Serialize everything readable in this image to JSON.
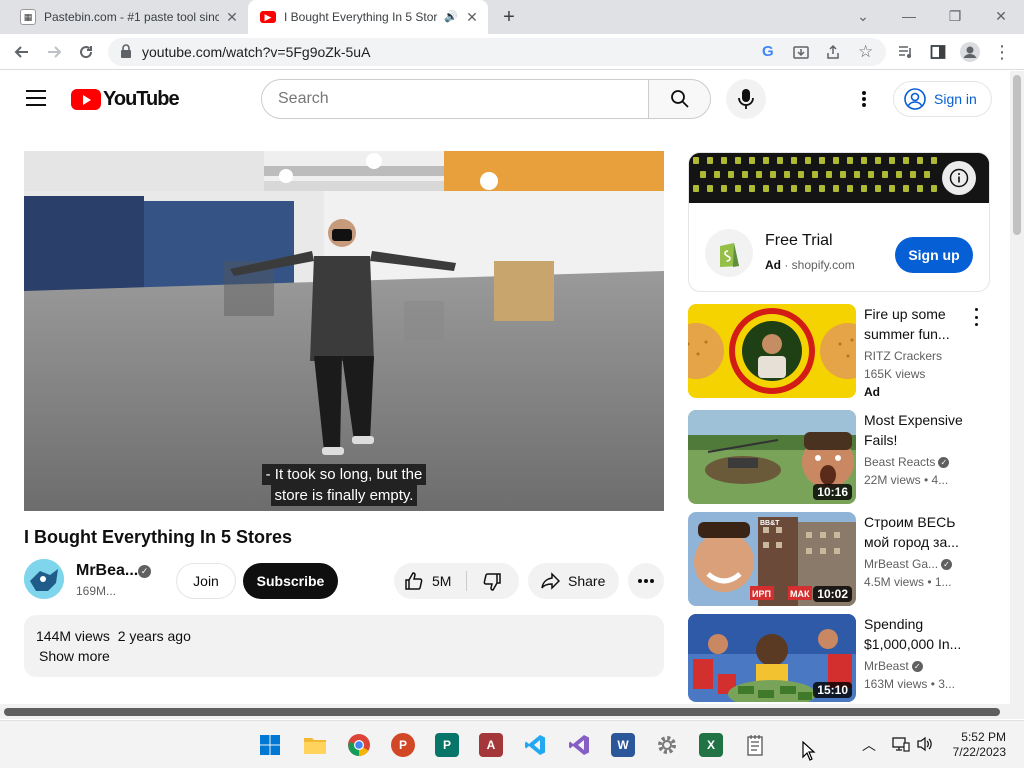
{
  "browser": {
    "tabs": [
      {
        "title": "Pastebin.com - #1 paste tool sinc",
        "favicon": "pastebin-icon"
      },
      {
        "title": "I Bought Everything In 5 Stor",
        "favicon": "youtube-icon",
        "audio": true
      }
    ],
    "url": "youtube.com/watch?v=5Fg9oZk-5uA"
  },
  "header": {
    "logo_text": "YouTube",
    "search_placeholder": "Search",
    "signin_label": "Sign in"
  },
  "video": {
    "caption_line1": "- It took so long, but the",
    "caption_line2": "store is finally empty.",
    "title": "I Bought Everything In 5 Stores",
    "channel": "MrBea...",
    "subscribers": "169M...",
    "join_label": "Join",
    "subscribe_label": "Subscribe",
    "likes": "5M",
    "share_label": "Share",
    "views": "144M views",
    "age": "2 years ago",
    "show_more": "Show more"
  },
  "ad": {
    "title": "Free Trial",
    "badge": "Ad",
    "domain": "shopify.com",
    "cta": "Sign up"
  },
  "recommendations": [
    {
      "title": "Fire up some summer fun...",
      "channel": "RITZ Crackers",
      "meta": "165K views",
      "ad": "Ad",
      "duration": ""
    },
    {
      "title": "Most Expensive Fails!",
      "channel": "Beast Reacts",
      "meta": "22M views • 4...",
      "duration": "10:16"
    },
    {
      "title": "Строим ВЕСЬ мой город за...",
      "channel": "MrBeast Ga...",
      "meta": "4.5M views • 1...",
      "duration": "10:02"
    },
    {
      "title": "Spending $1,000,000 In...",
      "channel": "MrBeast",
      "meta": "163M views • 3...",
      "duration": "15:10"
    }
  ],
  "thumb_text": {
    "store_sign": "BB&T",
    "left_caption": "ИРП",
    "right_caption": "МАК"
  },
  "taskbar": {
    "time": "5:52 PM",
    "date": "7/22/2023",
    "apps": [
      "windows-start",
      "file-explorer",
      "chrome",
      "powerpoint",
      "publisher",
      "access",
      "vs-code",
      "visual-studio",
      "word",
      "settings",
      "excel",
      "notepad"
    ]
  },
  "colors": {
    "brand_red": "#ff0000",
    "link_blue": "#065fd4",
    "subscribe_black": "#0f0f0f"
  }
}
